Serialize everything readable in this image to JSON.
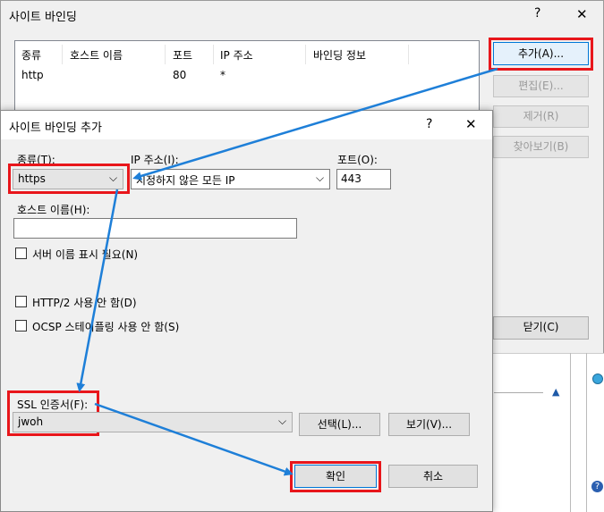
{
  "bg_window": {
    "title": "사이트 바인딩",
    "help_glyph": "?",
    "close_glyph": "✕",
    "columns": [
      "종류",
      "호스트 이름",
      "포트",
      "IP 주소",
      "바인딩 정보"
    ],
    "rows": [
      {
        "type": "http",
        "host": "",
        "port": "80",
        "ip": "*",
        "info": ""
      }
    ],
    "buttons": {
      "add": "추가(A)...",
      "edit": "편집(E)...",
      "remove": "제거(R)",
      "browse": "찾아보기(B)",
      "close": "닫기(C)"
    }
  },
  "dialog": {
    "title": "사이트 바인딩 추가",
    "help_glyph": "?",
    "close_glyph": "✕",
    "type_label": "종류(T):",
    "type_value": "https",
    "ip_label": "IP 주소(I):",
    "ip_value": "지정하지 않은 모든 IP",
    "port_label": "포트(O):",
    "port_value": "443",
    "host_label": "호스트 이름(H):",
    "host_value": "",
    "sni_label": "서버 이름 표시 필요(N)",
    "http2_label": "HTTP/2 사용 안 함(D)",
    "ocsp_label": "OCSP 스테이플링 사용 안 함(S)",
    "ssl_label": "SSL 인증서(F):",
    "ssl_value": "jwoh",
    "select_button": "선택(L)...",
    "view_button": "보기(V)...",
    "ok_button": "확인",
    "cancel_button": "취소"
  },
  "colors": {
    "highlight_red": "#e8161b",
    "arrow_blue": "#1e7fd8"
  }
}
